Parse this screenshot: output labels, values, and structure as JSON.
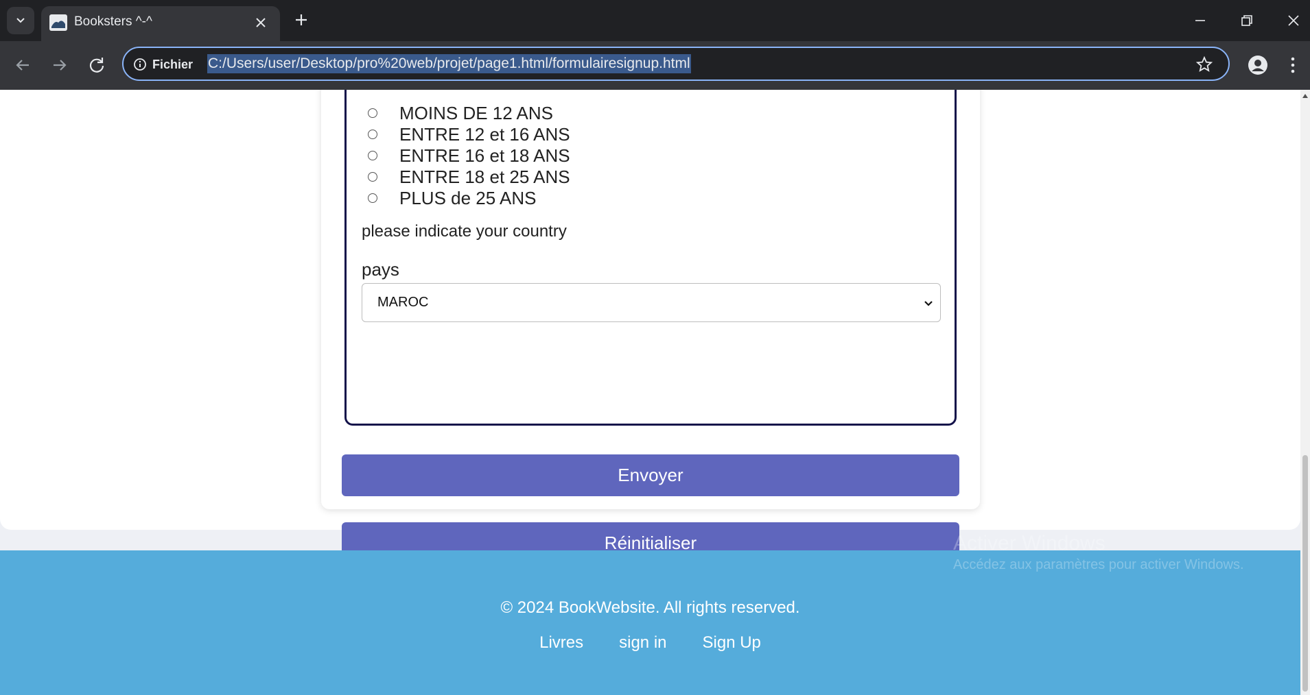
{
  "browser": {
    "tab_title": "Booksters ^-^",
    "site_info_label": "Fichier",
    "url": "C:/Users/user/Desktop/pro%20web/projet/page1.html/formulairesignup.html"
  },
  "form": {
    "age_options": [
      "MOINS DE 12 ANS",
      "ENTRE 12 et 16 ANS",
      "ENTRE 16 et 18 ANS",
      "ENTRE 18 et 25 ANS",
      "PLUS de 25 ANS"
    ],
    "country_hint": "please indicate your country",
    "country_label": "pays",
    "country_selected": "MAROC",
    "submit_label": "Envoyer",
    "reset_label": "Réinitialiser"
  },
  "footer": {
    "copyright": "© 2024 BookWebsite. All rights reserved.",
    "links": [
      "Livres",
      "sign in",
      "Sign Up"
    ]
  },
  "watermark": {
    "title": "Activer Windows",
    "subtitle": "Accédez aux paramètres pour activer Windows."
  },
  "colors": {
    "accent_button": "#5f66bd",
    "footer_bg": "#55acdb",
    "fieldset_border": "#14134a"
  }
}
